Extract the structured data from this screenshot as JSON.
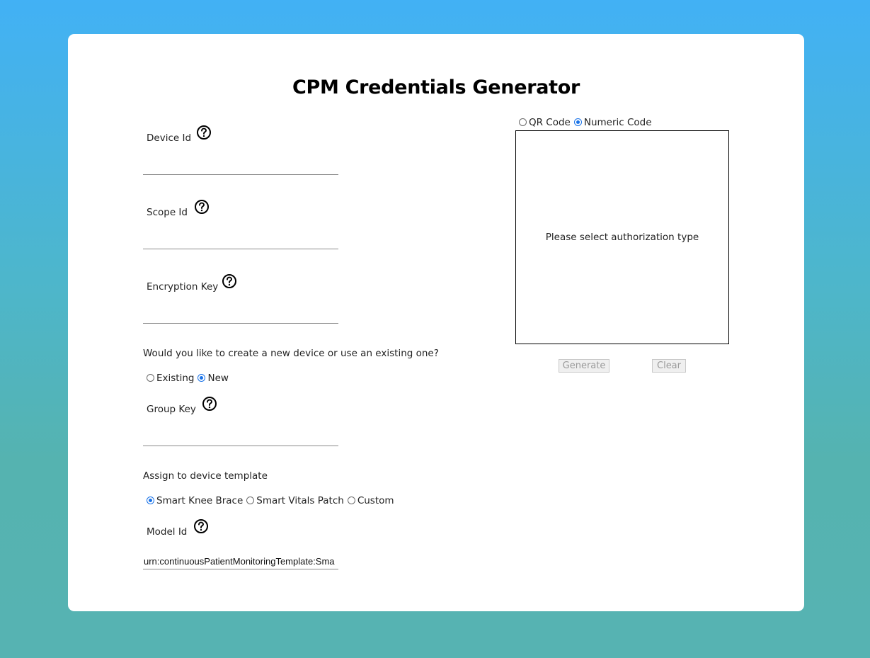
{
  "title": "CPM Credentials Generator",
  "fields": {
    "device_id": {
      "label": "Device Id",
      "value": ""
    },
    "scope_id": {
      "label": "Scope Id",
      "value": ""
    },
    "encryption_key": {
      "label": "Encryption Key",
      "value": ""
    },
    "group_key": {
      "label": "Group Key",
      "value": ""
    },
    "model_id": {
      "label": "Model Id",
      "value": "urn:continuousPatientMonitoringTemplate:Sma"
    }
  },
  "device_question": "Would you like to create a new device or use an existing one?",
  "device_options": {
    "existing": "Existing",
    "new": "New",
    "selected": "New"
  },
  "template_question": "Assign to device template",
  "template_options": {
    "knee": "Smart Knee Brace",
    "vitals": "Smart Vitals Patch",
    "custom": "Custom",
    "selected": "Smart Knee Brace"
  },
  "auth_options": {
    "qr": "QR Code",
    "numeric": "Numeric Code",
    "selected": "Numeric Code"
  },
  "auth_message": "Please select authorization type",
  "buttons": {
    "generate": "Generate",
    "clear": "Clear"
  },
  "icons": {
    "help": "question-circle-icon"
  },
  "colors": {
    "accent": "#1a73e8",
    "bg_top": "#42b1f5",
    "bg_bottom": "#56b3b2"
  }
}
